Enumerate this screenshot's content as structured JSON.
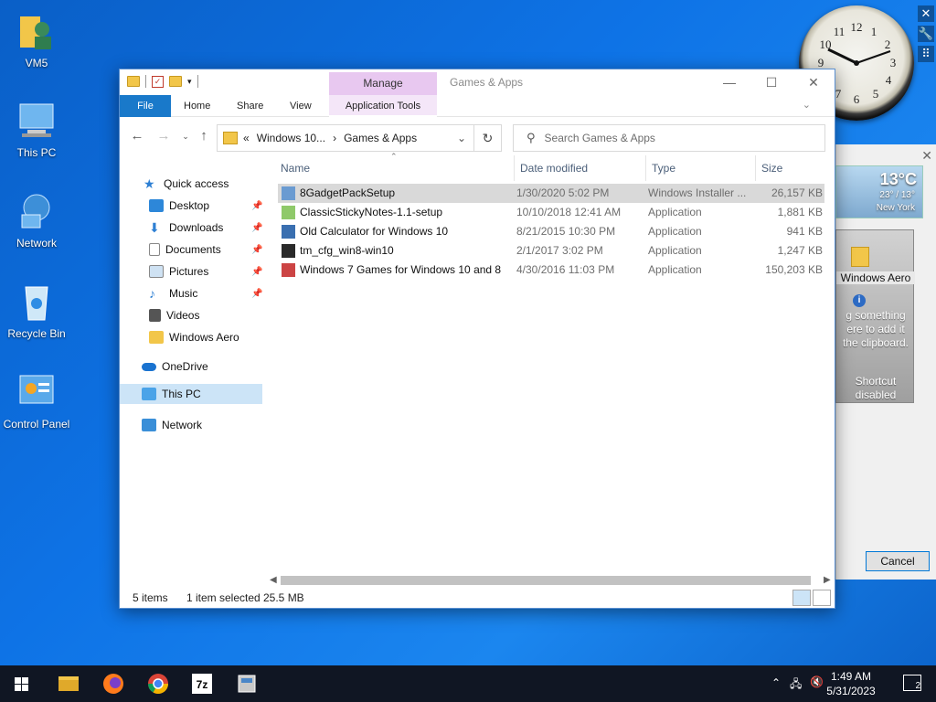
{
  "desktop": {
    "icons": [
      {
        "label": "VM5"
      },
      {
        "label": "This PC"
      },
      {
        "label": "Network"
      },
      {
        "label": "Recycle Bin"
      },
      {
        "label": "Control Panel"
      }
    ]
  },
  "clock": {
    "numbers": [
      "12",
      "1",
      "2",
      "3",
      "4",
      "5",
      "6",
      "7",
      "8",
      "9",
      "10",
      "11"
    ]
  },
  "window": {
    "title": "Games & Apps",
    "context_tab": "Manage",
    "tabs": {
      "file": "File",
      "home": "Home",
      "share": "Share",
      "view": "View",
      "app_tools": "Application Tools"
    },
    "address": {
      "prefix": "«",
      "segments": [
        "Windows 10...",
        "Games & Apps"
      ]
    },
    "search_placeholder": "Search Games & Apps",
    "nav": {
      "quick_access": "Quick access",
      "desktop": "Desktop",
      "downloads": "Downloads",
      "documents": "Documents",
      "pictures": "Pictures",
      "music": "Music",
      "videos": "Videos",
      "windows_aero": "Windows Aero",
      "onedrive": "OneDrive",
      "this_pc": "This PC",
      "network": "Network"
    },
    "columns": {
      "name": "Name",
      "date": "Date modified",
      "type": "Type",
      "size": "Size"
    },
    "files": [
      {
        "name": "8GadgetPackSetup",
        "date": "1/30/2020 5:02 PM",
        "type": "Windows Installer ...",
        "size": "26,157 KB"
      },
      {
        "name": "ClassicStickyNotes-1.1-setup",
        "date": "10/10/2018 12:41 AM",
        "type": "Application",
        "size": "1,881 KB"
      },
      {
        "name": "Old Calculator for Windows 10",
        "date": "8/21/2015 10:30 PM",
        "type": "Application",
        "size": "941 KB"
      },
      {
        "name": "tm_cfg_win8-win10",
        "date": "2/1/2017 3:02 PM",
        "type": "Application",
        "size": "1,247 KB"
      },
      {
        "name": "Windows 7 Games for Windows 10 and 8",
        "date": "4/30/2016 11:03 PM",
        "type": "Application",
        "size": "150,203 KB"
      }
    ],
    "status": {
      "count": "5 items",
      "selected": "1 item selected",
      "size": "25.5 MB"
    }
  },
  "weather": {
    "temp": "13°C",
    "range": "23° / 13°",
    "city": "New York"
  },
  "aero_gadget": {
    "folder": "Windows Aero",
    "info_lines": [
      "g something",
      "ere to add it",
      "the clipboard."
    ],
    "shortcut_lines": [
      "Shortcut",
      "disabled"
    ]
  },
  "dialog": {
    "cancel": "Cancel"
  },
  "taskbar": {
    "time": "1:49 AM",
    "date": "5/31/2023",
    "notifications": "2"
  },
  "colors": {
    "accent": "#1979ca",
    "manage_tab": "#e8c8f0",
    "selection": "#d9d9d9",
    "taskbar": "#101623"
  }
}
